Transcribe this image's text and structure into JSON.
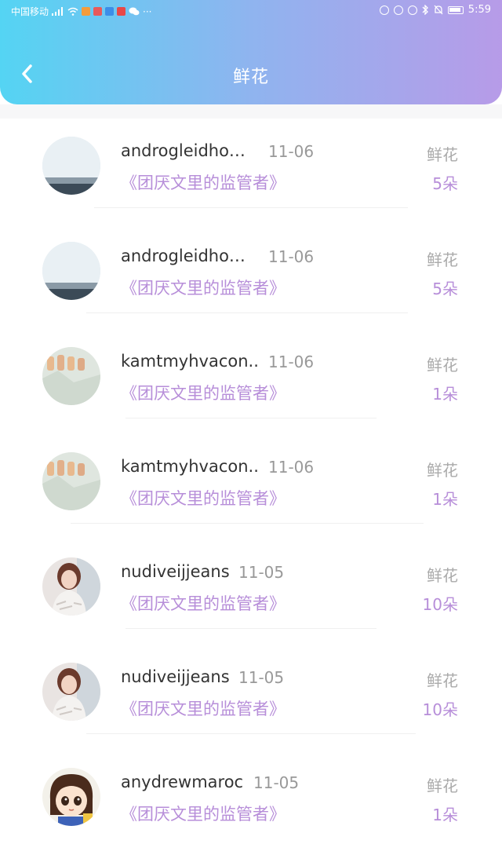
{
  "status_bar": {
    "carrier": "中国移动",
    "time": "5:59",
    "more": "···"
  },
  "header": {
    "title": "鲜花",
    "back_icon": "chevron-left-icon"
  },
  "records": [
    {
      "name": "androgleidho…",
      "date": "11-06",
      "book": "《团厌文里的监管者》",
      "gift": "鲜花",
      "count": "5朵",
      "avatar": "sea-landscape"
    },
    {
      "name": "androgleidho…",
      "date": "11-06",
      "book": "《团厌文里的监管者》",
      "gift": "鲜花",
      "count": "5朵",
      "avatar": "sea-landscape"
    },
    {
      "name": "kamtmyhvacon..",
      "date": "11-06",
      "book": "《团厌文里的监管者》",
      "gift": "鲜花",
      "count": "1朵",
      "avatar": "fingers-photo"
    },
    {
      "name": "kamtmyhvacon..",
      "date": "11-06",
      "book": "《团厌文里的监管者》",
      "gift": "鲜花",
      "count": "1朵",
      "avatar": "fingers-photo"
    },
    {
      "name": "nudiveijjeans",
      "date": "11-05",
      "book": "《团厌文里的监管者》",
      "gift": "鲜花",
      "count": "10朵",
      "avatar": "girl-photo"
    },
    {
      "name": "nudiveijjeans",
      "date": "11-05",
      "book": "《团厌文里的监管者》",
      "gift": "鲜花",
      "count": "10朵",
      "avatar": "girl-photo"
    },
    {
      "name": "anydrewmaroc",
      "date": "11-05",
      "book": "《团厌文里的监管者》",
      "gift": "鲜花",
      "count": "1朵",
      "avatar": "cartoon-girl"
    }
  ],
  "colors": {
    "header_gradient_start": "#54d4f3",
    "header_gradient_end": "#b79be8",
    "accent_purple": "#b78ed9",
    "name_text": "#333333",
    "muted_text": "#999999"
  }
}
